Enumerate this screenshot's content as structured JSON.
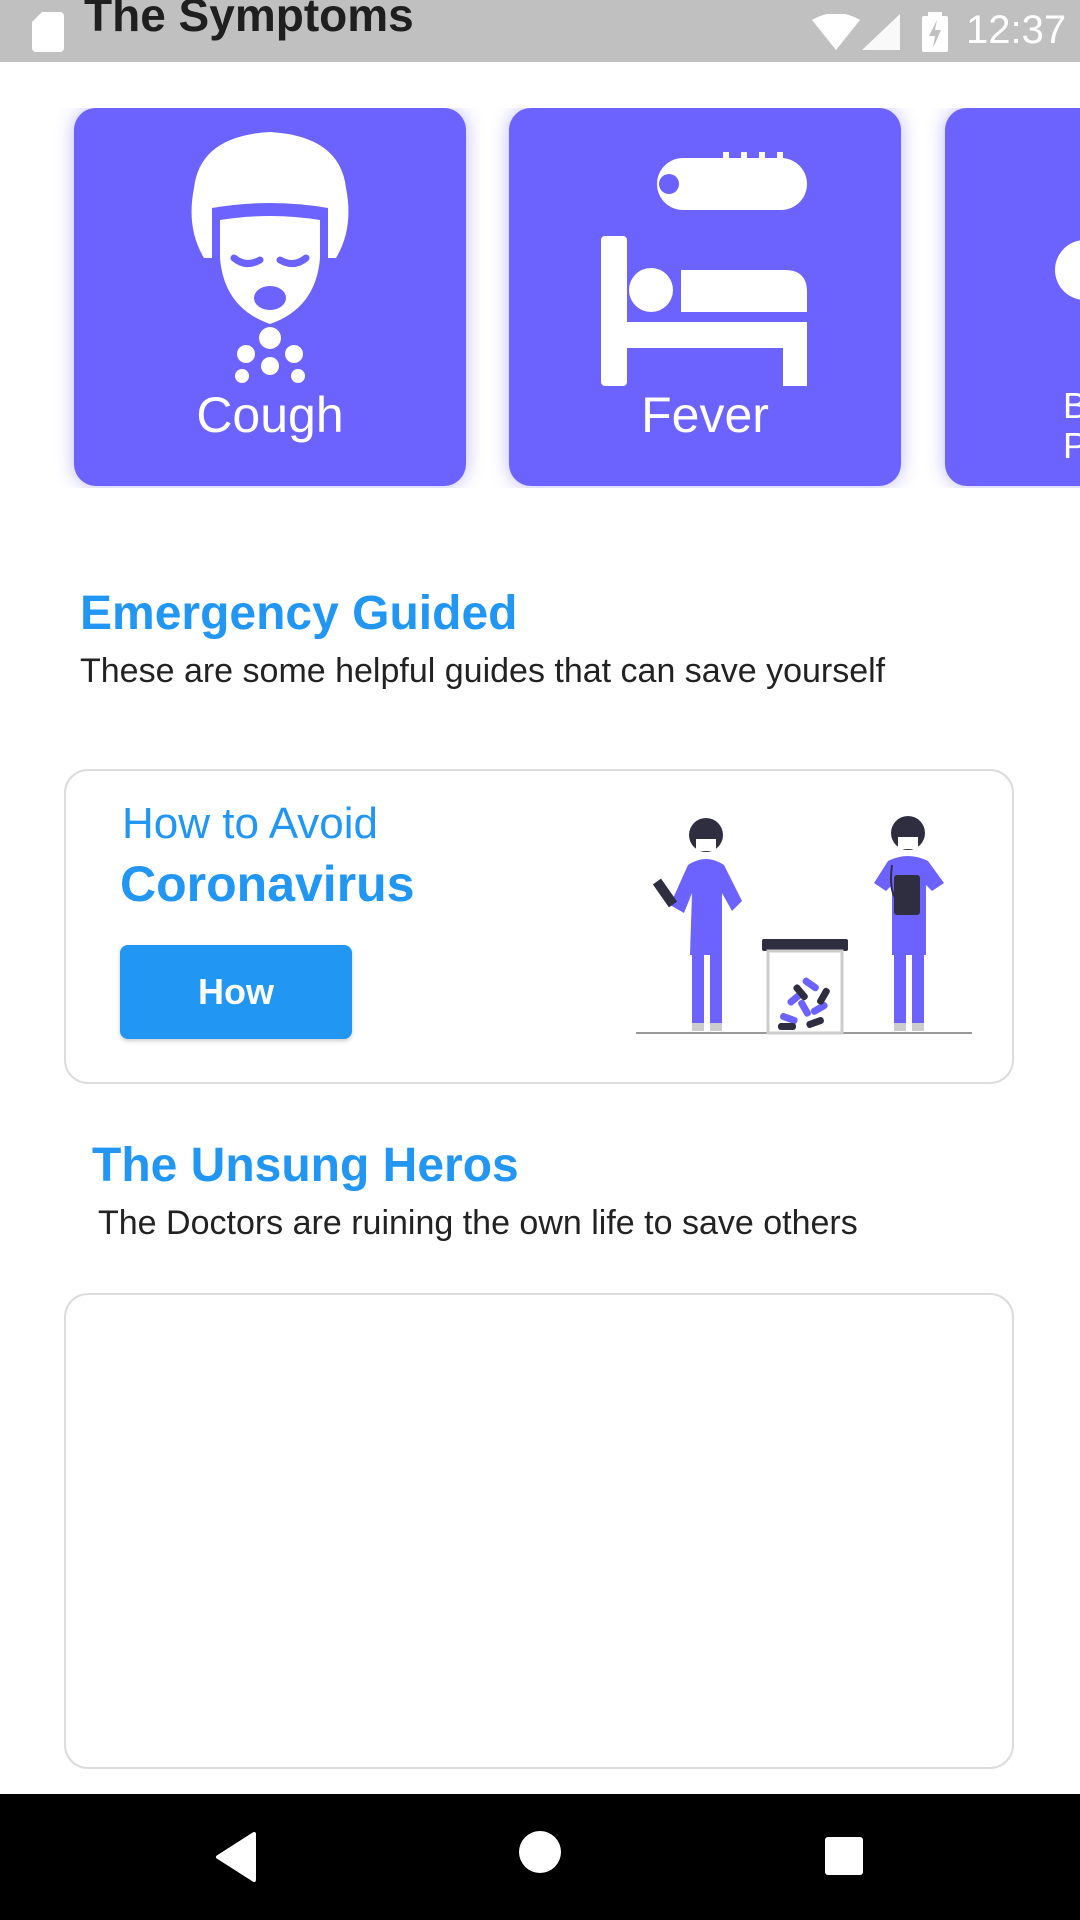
{
  "status_bar": {
    "title": "The Symptoms",
    "time": "12:37",
    "icons": [
      "sd-card-icon",
      "wifi-icon",
      "signal-icon",
      "battery-charging-icon"
    ]
  },
  "symptoms": {
    "items": [
      {
        "label": "Cough",
        "icon": "cough-face-icon"
      },
      {
        "label": "Fever",
        "icon": "fever-bed-icon"
      },
      {
        "label_line1": "B",
        "label_line2": "P"
      }
    ]
  },
  "emergency": {
    "title": "Emergency Guided",
    "subtitle": "These are some helpful guides that can save yourself"
  },
  "guide_card": {
    "line1": "How to Avoid",
    "line2": "Coronavirus",
    "button_label": "How",
    "illustration": "doctors-illustration"
  },
  "heroes": {
    "title": "The Unsung Heros",
    "subtitle": "The Doctors are ruining the own life to save others"
  },
  "colors": {
    "accent": "#2196f3",
    "card": "#6c63ff",
    "status_bar": "#c0c0c0"
  },
  "nav_bar": {
    "icons": [
      "back-icon",
      "home-icon",
      "recent-apps-icon"
    ]
  }
}
